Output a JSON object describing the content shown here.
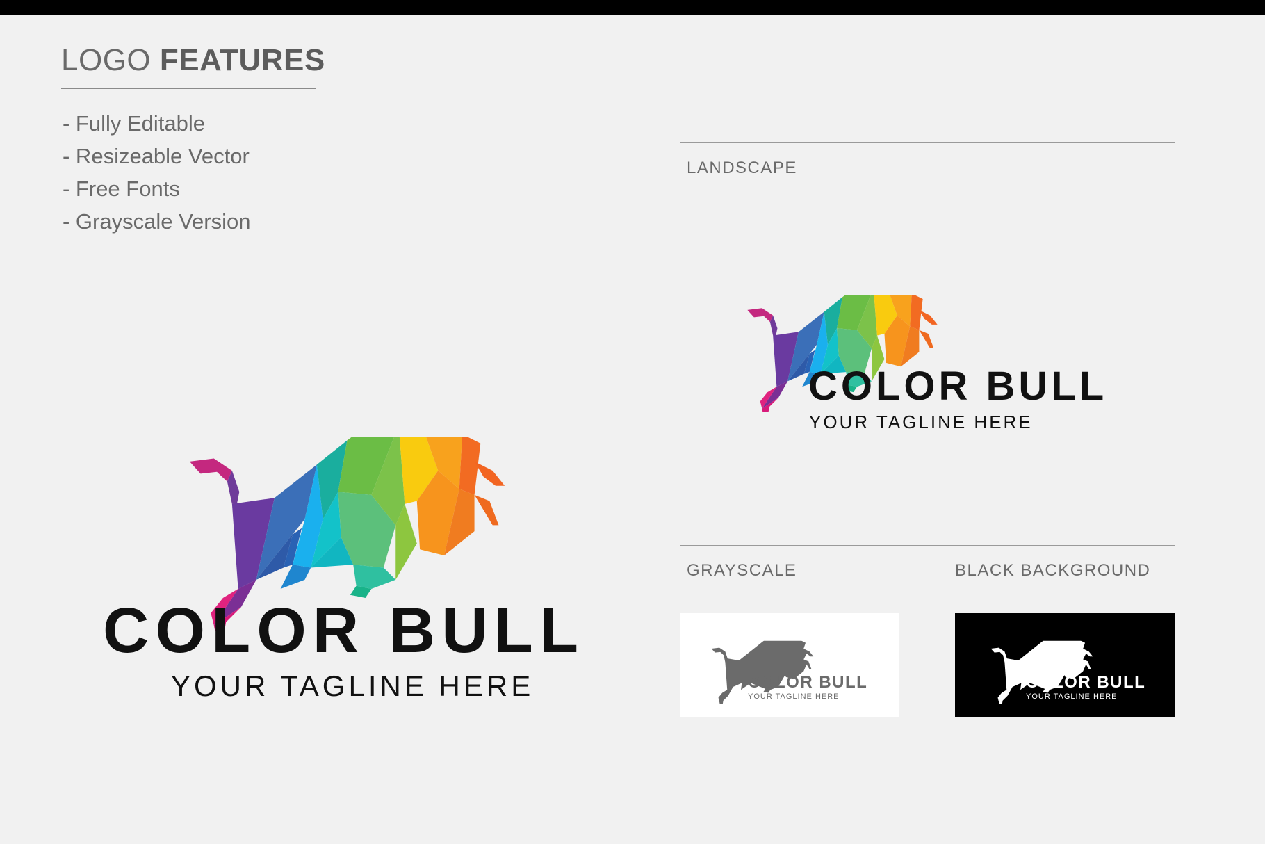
{
  "header": {
    "title_light": "LOGO",
    "title_bold": "FEATURES"
  },
  "features": [
    "- Fully Editable",
    "- Resizeable Vector",
    "- Free Fonts",
    "- Grayscale Version"
  ],
  "main_logo": {
    "brand": "COLOR BULL",
    "tagline": "YOUR TAGLINE HERE",
    "icon": "bull-icon"
  },
  "landscape": {
    "label": "LANDSCAPE",
    "brand": "COLOR BULL",
    "tagline": "YOUR TAGLINE HERE"
  },
  "grayscale": {
    "label": "GRAYSCALE",
    "brand": "COLOR BULL",
    "tagline": "YOUR TAGLINE HERE",
    "color": "#6b6b6b",
    "background": "#ffffff"
  },
  "black_background": {
    "label": "BLACK BACKGROUND",
    "brand": "COLOR BULL",
    "tagline": "YOUR TAGLINE HERE",
    "color": "#ffffff",
    "background": "#000000"
  },
  "palette": [
    "#d81b7a",
    "#7b3fa0",
    "#2f5fae",
    "#1aa6e6",
    "#14b8b0",
    "#4cb868",
    "#8cc63f",
    "#f9c80e",
    "#f7941d",
    "#f26522"
  ]
}
